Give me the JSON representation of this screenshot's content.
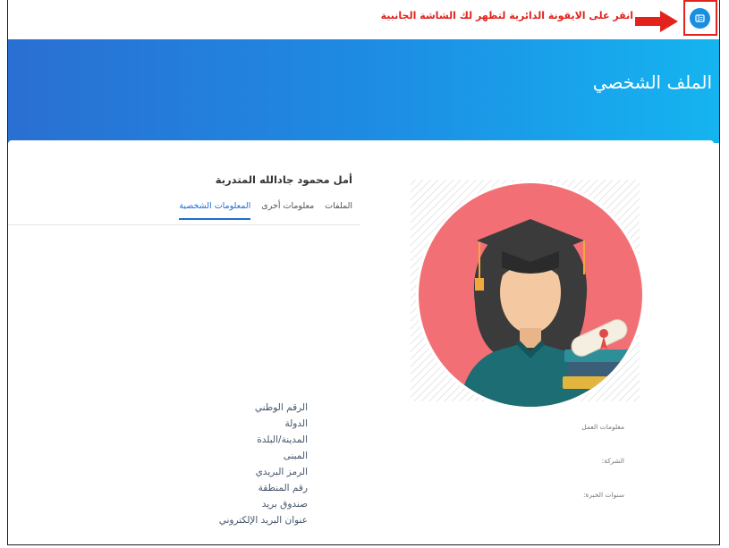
{
  "topbar": {
    "callout_text": "انقر على الايقونة الدائرية لتظهر لك الشاشة الجانبية"
  },
  "header": {
    "title": "الملف الشخصي"
  },
  "profile": {
    "name": "أمل محمود جادالله المتدربة",
    "tabs": [
      {
        "label": "المعلومات الشخصية",
        "active": true
      },
      {
        "label": "معلومات أخرى",
        "active": false
      },
      {
        "label": "الملفات",
        "active": false
      }
    ]
  },
  "fields": {
    "national_id": "الرقم الوطني",
    "country": "الدولة",
    "city": "المدينة/البلدة",
    "building": "المبنى",
    "postal_code": "الرمز البريدي",
    "area_number": "رقم المنطقة",
    "po_box": "صندوق بريد",
    "email": "عنوان البريد الإلكتروني"
  },
  "work": {
    "heading": "معلومات العمل",
    "company": "الشركة:",
    "experience": "سنوات الخبرة:"
  },
  "colors": {
    "accent": "#1e6fd0",
    "callout": "#e0231c",
    "avatar_bg": "#f27075"
  },
  "icons": {
    "sidebar_toggle": "sidebar-toggle-icon",
    "arrow": "arrow-right-icon",
    "avatar": "graduate-avatar-icon"
  }
}
